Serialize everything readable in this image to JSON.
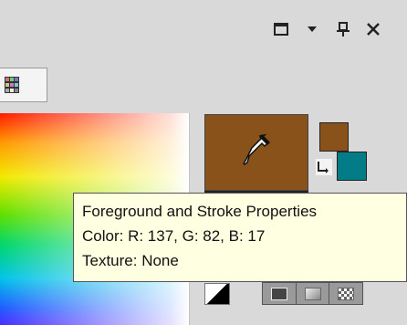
{
  "window": {
    "restore_icon": "restore-icon",
    "menu_icon": "dropdown-arrow-icon",
    "pin_icon": "pin-icon",
    "close_icon": "close-icon"
  },
  "palette": {
    "mode_icon": "palette-grid-icon"
  },
  "colors": {
    "foreground": "#89521a",
    "background": "#047c88",
    "panel": "#d9d9d9",
    "tooltip_bg": "#ffffe1"
  },
  "tooltip": {
    "line1": "Foreground and Stroke Properties",
    "line2": "Color: R: 137, G: 82, B: 17",
    "line3": "Texture: None"
  },
  "controls": {
    "eyedropper_icon": "eyedropper-icon",
    "swap_icon": "swap-colors-icon",
    "default_colors_icon": "black-white-icon",
    "modes": [
      "solid-color-icon",
      "gradient-icon",
      "pattern-icon"
    ]
  }
}
